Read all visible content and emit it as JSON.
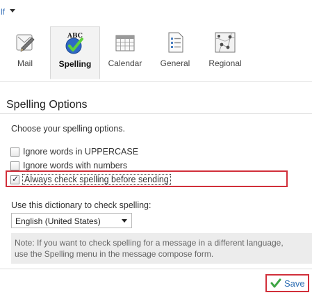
{
  "header": {
    "user_name": "lf"
  },
  "nav": {
    "items": [
      {
        "label": "Mail"
      },
      {
        "label": "Spelling"
      },
      {
        "label": "Calendar"
      },
      {
        "label": "General"
      },
      {
        "label": "Regional"
      }
    ],
    "active": "Spelling",
    "spelling_icon_text": "ABC"
  },
  "section": {
    "title": "Spelling Options"
  },
  "intro": "Choose your spelling options.",
  "options": [
    {
      "label": "Ignore words in UPPERCASE",
      "checked": false
    },
    {
      "label": "Ignore words with numbers",
      "checked": false
    },
    {
      "label": "Always check spelling before sending",
      "checked": true
    }
  ],
  "dictionary": {
    "label": "Use this dictionary to check spelling:",
    "selected": "English (United States)"
  },
  "note": {
    "line1": "Note: If you want to check spelling for a message in a different language,",
    "line2": "use the Spelling menu in the message compose form."
  },
  "footer": {
    "save_label": "Save"
  },
  "colors": {
    "highlight": "#d12f3a",
    "link": "#3b73b9",
    "save_check": "#3da544"
  }
}
